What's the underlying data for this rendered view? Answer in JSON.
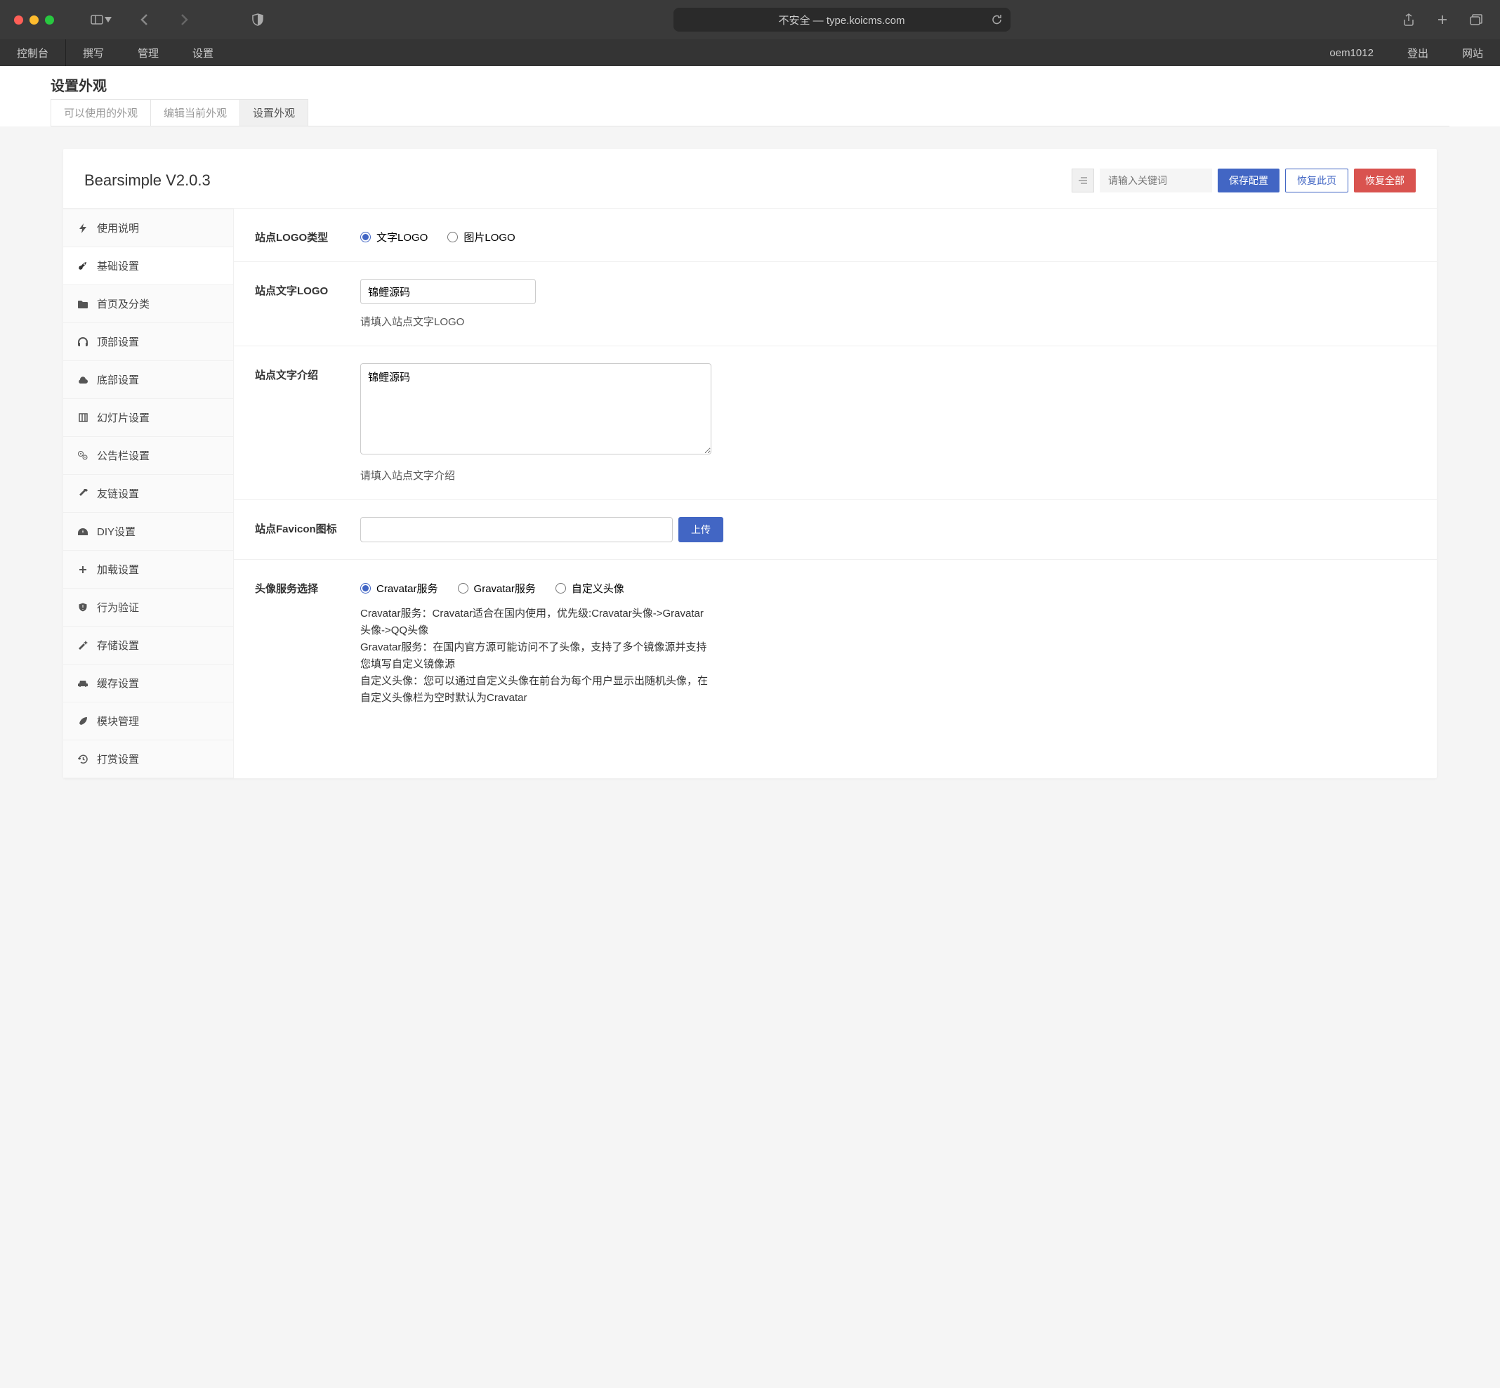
{
  "browser": {
    "url": "不安全 — type.koicms.com"
  },
  "topnav": {
    "left": [
      "控制台",
      "撰写",
      "管理",
      "设置"
    ],
    "right": [
      "oem1012",
      "登出",
      "网站"
    ]
  },
  "page": {
    "title": "设置外观",
    "tabs": [
      {
        "label": "可以使用的外观",
        "active": false
      },
      {
        "label": "编辑当前外观",
        "active": false
      },
      {
        "label": "设置外观",
        "active": true
      }
    ]
  },
  "card": {
    "title": "Bearsimple V2.0.3",
    "search_placeholder": "请输入关键词",
    "btn_save": "保存配置",
    "btn_restore_page": "恢复此页",
    "btn_restore_all": "恢复全部"
  },
  "sidebar": {
    "items": [
      {
        "icon": "bolt",
        "label": "使用说明"
      },
      {
        "icon": "rocket",
        "label": "基础设置"
      },
      {
        "icon": "folder",
        "label": "首页及分类"
      },
      {
        "icon": "headphones",
        "label": "顶部设置"
      },
      {
        "icon": "cloud",
        "label": "底部设置"
      },
      {
        "icon": "slides",
        "label": "幻灯片设置"
      },
      {
        "icon": "gears",
        "label": "公告栏设置"
      },
      {
        "icon": "hammer",
        "label": "友链设置"
      },
      {
        "icon": "dashboard",
        "label": "DIY设置"
      },
      {
        "icon": "plus",
        "label": "加载设置"
      },
      {
        "icon": "shield-alert",
        "label": "行为验证"
      },
      {
        "icon": "wand",
        "label": "存储设置"
      },
      {
        "icon": "car",
        "label": "缓存设置"
      },
      {
        "icon": "leaf",
        "label": "模块管理"
      },
      {
        "icon": "history",
        "label": "打赏设置"
      }
    ]
  },
  "form": {
    "logo_type": {
      "label": "站点LOGO类型",
      "options": [
        "文字LOGO",
        "图片LOGO"
      ],
      "selected": 0
    },
    "text_logo": {
      "label": "站点文字LOGO",
      "value": "锦鲤源码",
      "hint": "请填入站点文字LOGO"
    },
    "text_intro": {
      "label": "站点文字介绍",
      "value": "锦鲤源码",
      "hint": "请填入站点文字介绍"
    },
    "favicon": {
      "label": "站点Favicon图标",
      "value": "",
      "upload": "上传"
    },
    "avatar": {
      "label": "头像服务选择",
      "options": [
        "Cravatar服务",
        "Gravatar服务",
        "自定义头像"
      ],
      "selected": 0,
      "desc": "Cravatar服务：Cravatar适合在国内使用，优先级:Cravatar头像->Gravatar头像->QQ头像\nGravatar服务：在国内官方源可能访问不了头像，支持了多个镜像源并支持您填写自定义镜像源\n自定义头像：您可以通过自定义头像在前台为每个用户显示出随机头像，在自定义头像栏为空时默认为Cravatar"
    }
  }
}
